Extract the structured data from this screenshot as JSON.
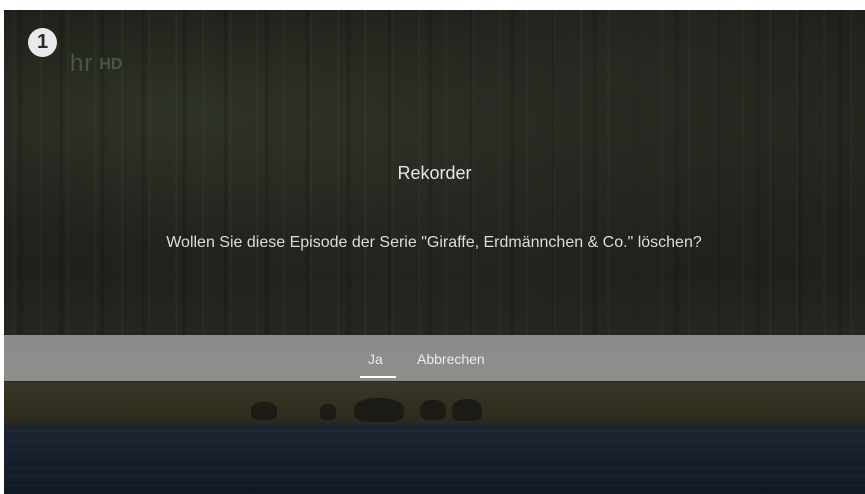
{
  "overlay": {
    "channel_number": "1",
    "channel_logo": "hr",
    "channel_logo_badge": "HD"
  },
  "dialog": {
    "title": "Rekorder",
    "message": "Wollen Sie diese Episode der Serie \"Giraffe, Erdmännchen & Co.\" löschen?",
    "actions": [
      {
        "label": "Ja",
        "focused": true
      },
      {
        "label": "Abbrechen",
        "focused": false
      }
    ]
  },
  "colors": {
    "action_bar": "#9b9b9b",
    "focus_underline": "#ffffff",
    "text": "#e6e6e6"
  }
}
